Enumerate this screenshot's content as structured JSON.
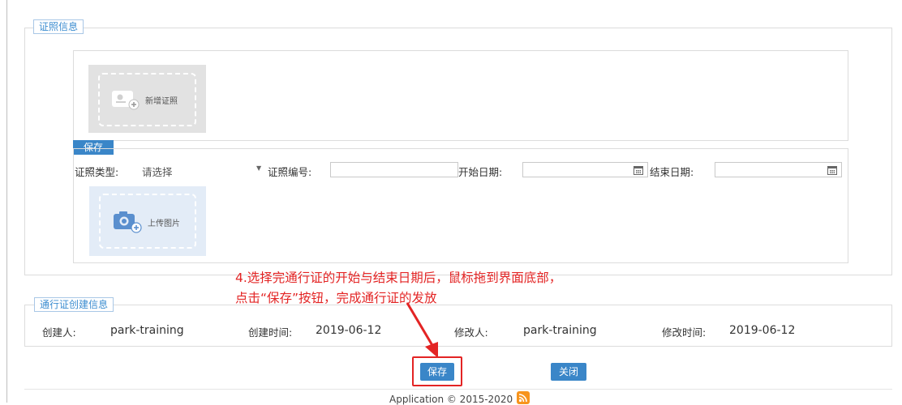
{
  "cert_section": {
    "legend": "证照信息",
    "add_cert_label": "新增证照",
    "save_tag": "保存",
    "type_label": "证照类型:",
    "type_selected": "请选择",
    "number_label": "证照编号:",
    "number_value": "",
    "start_label": "开始日期:",
    "start_value": "",
    "end_label": "结束日期:",
    "end_value": "",
    "upload_label": "上传图片"
  },
  "annotation": {
    "line1": "4.选择完通行证的开始与结束日期后，鼠标拖到界面底部，",
    "line2": "点击“保存”按钮，完成通行证的发放",
    "color": "#e32424"
  },
  "create_section": {
    "legend": "通行证创建信息",
    "creator_label": "创建人:",
    "creator_value": "park-training",
    "created_time_label": "创建时间:",
    "created_time_value": "2019-06-12",
    "modifier_label": "修改人:",
    "modifier_value": "park-training",
    "modified_time_label": "修改时间:",
    "modified_time_value": "2019-06-12"
  },
  "buttons": {
    "save": "保存",
    "close": "关闭"
  },
  "footer": {
    "text": "Application © 2015-2020"
  },
  "icons": [
    "id-card-add-icon",
    "calendar-icon",
    "camera-add-icon",
    "dropdown-arrow-icon",
    "rss-icon",
    "arrow-annotation-icon"
  ]
}
